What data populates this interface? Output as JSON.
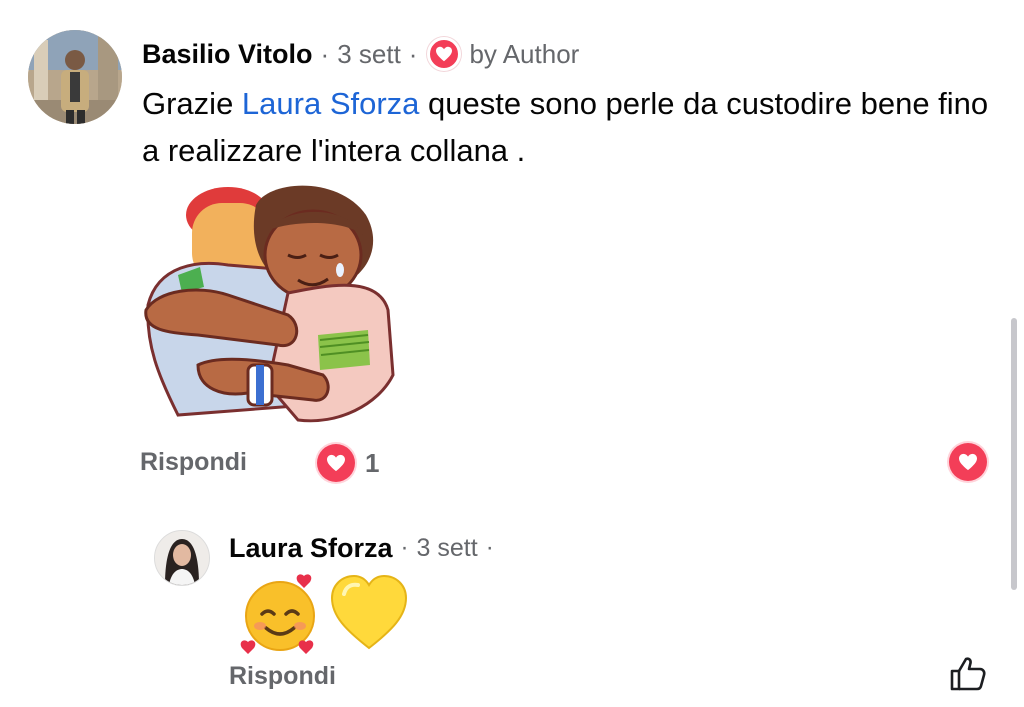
{
  "comment": {
    "author": "Basilio Vitolo",
    "time": "3 sett",
    "separator": "·",
    "badge_icon": "heart-icon",
    "badge_label": "by Author",
    "text_before": "Grazie ",
    "mention": "Laura Sforza",
    "text_after": " queste sono perle da custodire bene fino a realizzare l'intera collana .",
    "sticker": "hug-sticker",
    "reply_label": "Rispondi",
    "reaction_icon": "heart-icon",
    "reaction_count": "1"
  },
  "reply": {
    "author": "Laura Sforza",
    "time": "3 sett",
    "separator": "·",
    "emoji_1": "smiling-face-with-hearts",
    "emoji_2": "yellow-heart",
    "reply_label": "Rispondi",
    "like_icon": "thumbs-up-icon"
  },
  "colors": {
    "heart": "#f33e58",
    "mention": "#1d65d6",
    "meta_text": "#65676b"
  }
}
